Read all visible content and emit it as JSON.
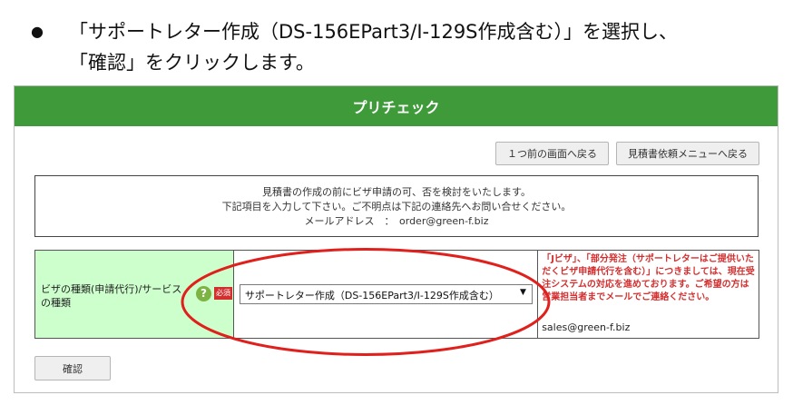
{
  "instruction": {
    "bullet": "●",
    "line1": "「サポートレター作成（DS-156EPart3/I-129S作成含む）」を選択し、",
    "line2": "「確認」をクリックします。"
  },
  "panel": {
    "header": "プリチェック",
    "nav": {
      "back_label": "１つ前の画面へ戻る",
      "menu_label": "見積書依頼メニューへ戻る"
    },
    "notice": {
      "line1": "見積書の作成の前にビザ申請の可、否を検討をいたします。",
      "line2": "下記項目を入力して下さい。ご不明点は下記の連絡先へお問い合せください。",
      "line3": "メールアドレス　：　order@green-f.biz"
    },
    "form": {
      "label_line1": "ビザの種類(申請代行)/サービス",
      "label_line2": "の種類",
      "help_icon": "?",
      "required_badge": "必須",
      "selected_value": "サポートレター作成（DS-156EPart3/I-129S作成含む）",
      "note": "「Jビザ」、「部分発注（サポートレターはご提供いただくビザ申請代行を含む）」につきましては、現在受注システムの対応を進めております。ご希望の方は営業担当者までメールでご連絡ください。",
      "note_email": "sales@green-f.biz"
    },
    "confirm_label": "確認"
  },
  "colors": {
    "header_green": "#3f9a3a",
    "label_bg": "#ccffcc",
    "note_red": "#d32f2f",
    "annotation_red": "#e0201c"
  }
}
